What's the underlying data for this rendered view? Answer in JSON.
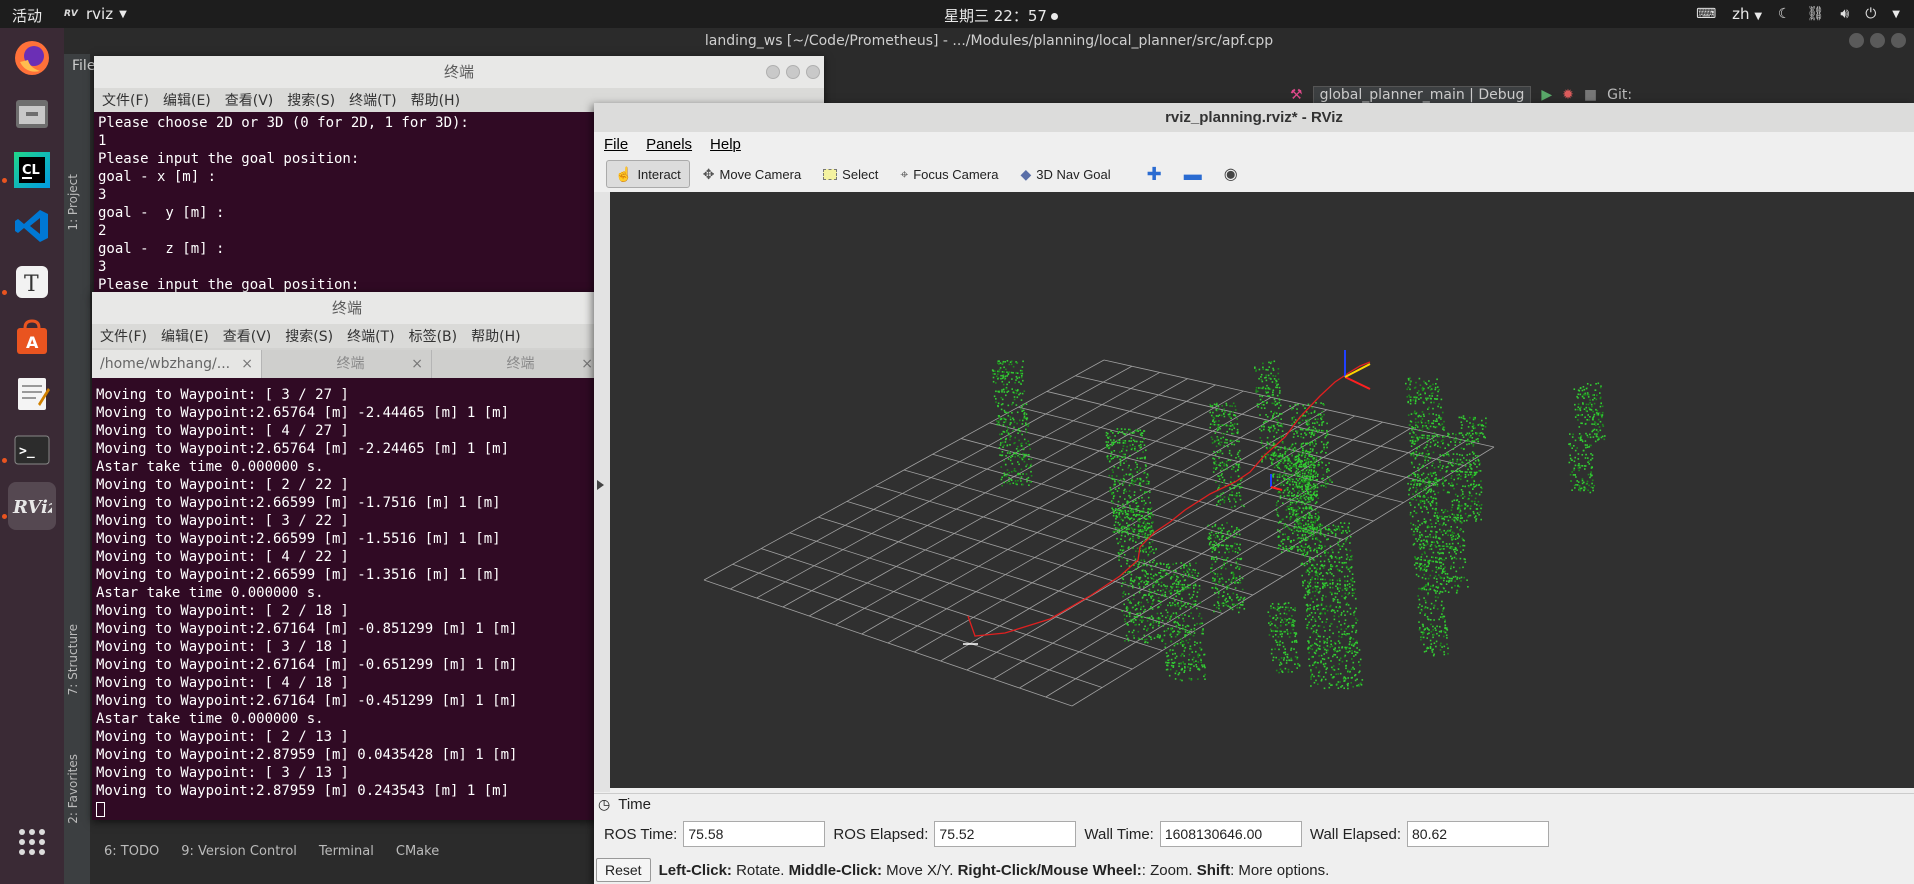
{
  "topbar": {
    "activities": "活动",
    "app_name": "rviz",
    "clock": "星期三 22：57",
    "lang": "zh"
  },
  "dock": {
    "items": [
      {
        "name": "firefox",
        "color": "#ff7139"
      },
      {
        "name": "files",
        "color": "#8c8c8c"
      },
      {
        "name": "clion",
        "label": "CL",
        "color": "#21d789"
      },
      {
        "name": "vscode",
        "color": "#007acc"
      },
      {
        "name": "typora",
        "label": "T",
        "color": "#eeeeee"
      },
      {
        "name": "software",
        "color": "#e95420"
      },
      {
        "name": "text-editor",
        "color": "#f0f0f0"
      },
      {
        "name": "terminal",
        "label": ">_",
        "color": "#2c2c2c"
      },
      {
        "name": "rviz",
        "label": "RViz",
        "color": "#3a3a3a"
      }
    ]
  },
  "ide": {
    "title": "landing_ws [~/Code/Prometheus] - .../Modules/planning/local_planner/src/apf.cpp",
    "menu_file": "File",
    "run_config": "global_planner_main | Debug",
    "git_label": "Git:",
    "side_tabs": [
      "1: Project",
      "7: Structure",
      "2: Favorites"
    ],
    "bottom_tabs": [
      "6: TODO",
      "9: Version Control",
      "Terminal",
      "CMake"
    ]
  },
  "terminal1": {
    "title": "终端",
    "menu": [
      "文件(F)",
      "编辑(E)",
      "查看(V)",
      "搜索(S)",
      "终端(T)",
      "帮助(H)"
    ],
    "lines": [
      "Please choose 2D or 3D (0 for 2D, 1 for 3D):",
      "1",
      "Please input the goal position:",
      "goal - x [m] :",
      "3",
      "goal -  y [m] :",
      "2",
      "goal -  z [m] :",
      "3",
      "Please input the goal position:"
    ]
  },
  "terminal2": {
    "title": "终端",
    "menu": [
      "文件(F)",
      "编辑(E)",
      "查看(V)",
      "搜索(S)",
      "终端(T)",
      "标签(B)",
      "帮助(H)"
    ],
    "tabs": [
      {
        "label": "/home/wbzhang/...",
        "close": "×"
      },
      {
        "label": "终端",
        "close": "×"
      },
      {
        "label": "终端",
        "close": "×"
      }
    ],
    "lines": [
      "Moving to Waypoint: [ 3 / 27 ]",
      "Moving to Waypoint:2.65764 [m] -2.44465 [m] 1 [m]",
      "Moving to Waypoint: [ 4 / 27 ]",
      "Moving to Waypoint:2.65764 [m] -2.24465 [m] 1 [m]",
      "Astar take time 0.000000 s.",
      "Moving to Waypoint: [ 2 / 22 ]",
      "Moving to Waypoint:2.66599 [m] -1.7516 [m] 1 [m]",
      "Moving to Waypoint: [ 3 / 22 ]",
      "Moving to Waypoint:2.66599 [m] -1.5516 [m] 1 [m]",
      "Moving to Waypoint: [ 4 / 22 ]",
      "Moving to Waypoint:2.66599 [m] -1.3516 [m] 1 [m]",
      "Astar take time 0.000000 s.",
      "Moving to Waypoint: [ 2 / 18 ]",
      "Moving to Waypoint:2.67164 [m] -0.851299 [m] 1 [m]",
      "Moving to Waypoint: [ 3 / 18 ]",
      "Moving to Waypoint:2.67164 [m] -0.651299 [m] 1 [m]",
      "Moving to Waypoint: [ 4 / 18 ]",
      "Moving to Waypoint:2.67164 [m] -0.451299 [m] 1 [m]",
      "Astar take time 0.000000 s.",
      "Moving to Waypoint: [ 2 / 13 ]",
      "Moving to Waypoint:2.87959 [m] 0.0435428 [m] 1 [m]",
      "Moving to Waypoint: [ 3 / 13 ]",
      "Moving to Waypoint:2.87959 [m] 0.243543 [m] 1 [m]"
    ]
  },
  "rviz": {
    "title": "rviz_planning.rviz* - RViz",
    "menu": [
      "File",
      "Panels",
      "Help"
    ],
    "tools": [
      {
        "label": "Interact",
        "icon": "hand-icon",
        "active": true
      },
      {
        "label": "Move Camera",
        "icon": "move-camera-icon",
        "active": false
      },
      {
        "label": "Select",
        "icon": "select-icon",
        "active": false
      },
      {
        "label": "Focus Camera",
        "icon": "focus-camera-icon",
        "active": false
      },
      {
        "label": "3D Nav Goal",
        "icon": "nav-goal-icon",
        "active": false
      }
    ],
    "time_panel": {
      "header": "Time",
      "ros_time_label": "ROS Time:",
      "ros_time": "75.58",
      "ros_elapsed_label": "ROS Elapsed:",
      "ros_elapsed": "75.52",
      "wall_time_label": "Wall Time:",
      "wall_time": "1608130646.00",
      "wall_elapsed_label": "Wall Elapsed:",
      "wall_elapsed": "80.62"
    },
    "help": {
      "reset": "Reset",
      "b1": "Left-Click:",
      "t1": " Rotate. ",
      "b2": "Middle-Click:",
      "t2": " Move X/Y. ",
      "b3": "Right-Click/Mouse Wheel:",
      "t3": ": Zoom. ",
      "b4": "Shift",
      "t4": ": More options."
    },
    "colors": {
      "background": "#303030",
      "grid": "#a0a0a0",
      "points": "#33cc33",
      "path": "#e02020"
    }
  }
}
